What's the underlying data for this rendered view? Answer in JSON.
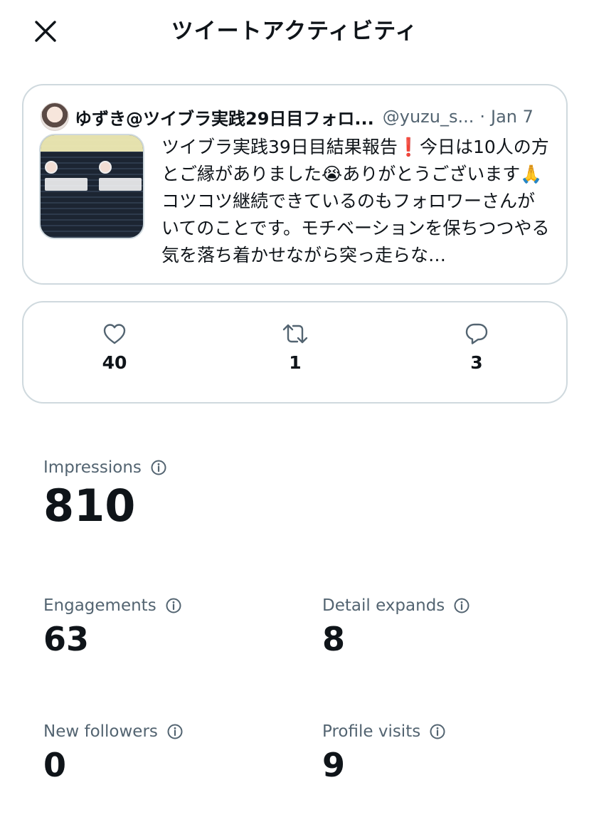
{
  "header": {
    "title": "ツイートアクティビティ",
    "close_icon": "close-icon"
  },
  "tweet": {
    "author_name": "ゆずき@ツイブラ実践29日目フォロ...",
    "handle": "@yuzu_s...",
    "separator": "·",
    "date": "Jan 7",
    "text": "ツイブラ実践39日目結果報告❗️今日は10人の方とご縁がありました😭ありがとうございます🙏コツコツ継続できているのもフォロワーさんがいてのことです。モチベーションを保ちつつやる気を落ち着かせながら突っ走らな…"
  },
  "engagement_counts": {
    "likes": {
      "icon": "heart-icon",
      "value": "40"
    },
    "retweets": {
      "icon": "retweet-icon",
      "value": "1"
    },
    "replies": {
      "icon": "reply-icon",
      "value": "3"
    }
  },
  "metrics": {
    "impressions": {
      "label": "Impressions",
      "value": "810"
    },
    "engagements": {
      "label": "Engagements",
      "value": "63"
    },
    "detail_expands": {
      "label": "Detail expands",
      "value": "8"
    },
    "new_followers": {
      "label": "New followers",
      "value": "0"
    },
    "profile_visits": {
      "label": "Profile visits",
      "value": "9"
    }
  },
  "colors": {
    "text_primary": "#0f1419",
    "text_secondary": "#536471",
    "border": "#cfd9de"
  }
}
